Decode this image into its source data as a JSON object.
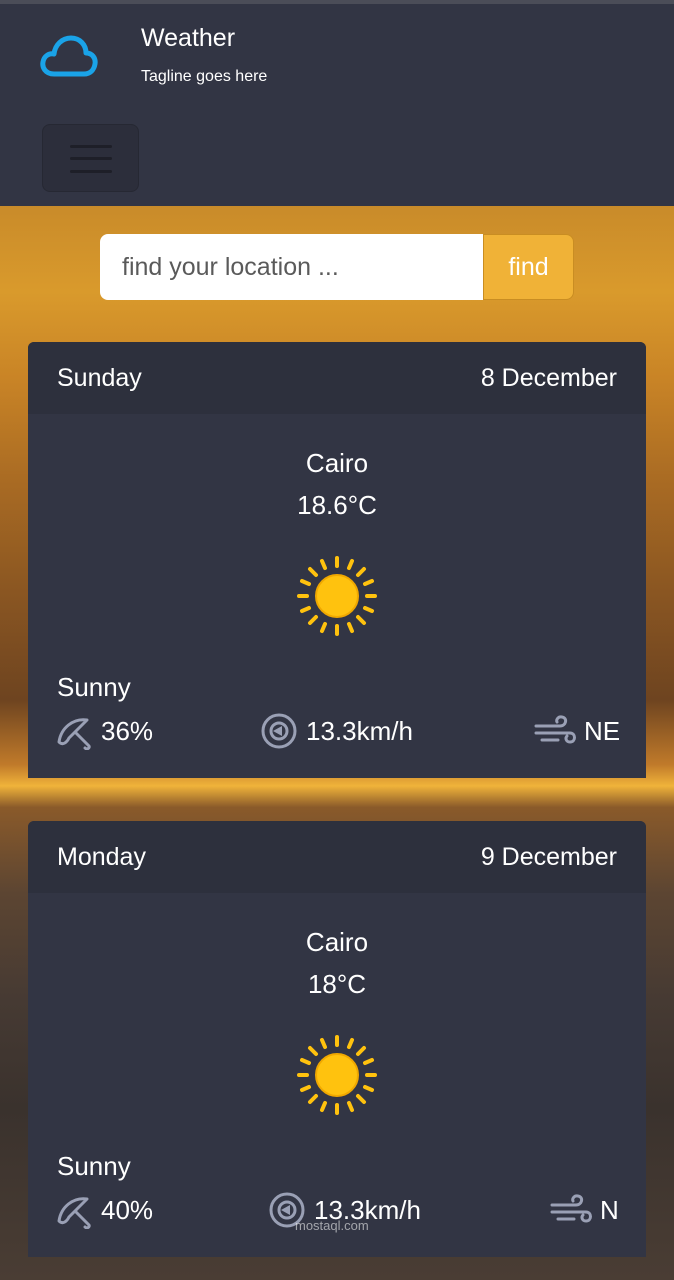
{
  "header": {
    "title": "Weather",
    "tagline": "Tagline goes here",
    "logo_icon": "cloud-icon",
    "menu_icon": "hamburger-icon"
  },
  "search": {
    "placeholder": "find your location ...",
    "button_label": "find"
  },
  "colors": {
    "accent": "#f0b237",
    "header_bg": "#323544",
    "card_bg": "#323544",
    "card_head_bg": "#2d303d",
    "logo": "#1aa3e8",
    "sun": "#ffc20e"
  },
  "forecast": [
    {
      "day": "Sunday",
      "date": "8 December",
      "city": "Cairo",
      "temperature": "18.6°C",
      "icon": "sun-icon",
      "condition": "Sunny",
      "rain": "36%",
      "wind_speed": "13.3km/h",
      "wind_direction": "NE"
    },
    {
      "day": "Monday",
      "date": "9 December",
      "city": "Cairo",
      "temperature": "18°C",
      "icon": "sun-icon",
      "condition": "Sunny",
      "rain": "40%",
      "wind_speed": "13.3km/h",
      "wind_direction": "N"
    }
  ],
  "watermark": "mostaql.com"
}
